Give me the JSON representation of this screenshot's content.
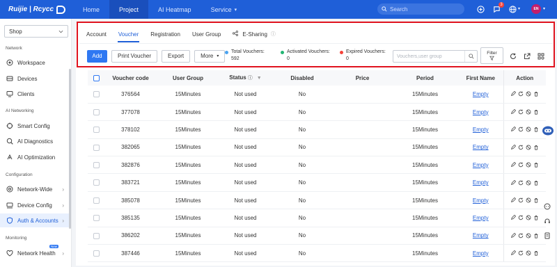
{
  "brand": {
    "logo_text": "Ruijie | Rcycc"
  },
  "topnav": {
    "items": [
      {
        "label": "Home"
      },
      {
        "label": "Project"
      },
      {
        "label": "AI Heatmap"
      },
      {
        "label": "Service"
      }
    ],
    "search_placeholder": "Search",
    "notification_count": "3",
    "avatar_text": "EN"
  },
  "sidebar": {
    "shop_select": "Shop",
    "sections": [
      {
        "title": "Network",
        "items": [
          {
            "label": "Workspace"
          },
          {
            "label": "Devices"
          },
          {
            "label": "Clients"
          }
        ]
      },
      {
        "title": "AI Networking",
        "items": [
          {
            "label": "Smart Config"
          },
          {
            "label": "AI Diagnostics"
          },
          {
            "label": "AI Optimization"
          }
        ]
      },
      {
        "title": "Configuration",
        "items": [
          {
            "label": "Network-Wide"
          },
          {
            "label": "Device Config"
          },
          {
            "label": "Auth & Accounts"
          }
        ]
      },
      {
        "title": "Monitoring",
        "items": [
          {
            "label": "Network Health"
          }
        ]
      }
    ],
    "new_tag": "New"
  },
  "tabs": [
    {
      "label": "Account"
    },
    {
      "label": "Voucher"
    },
    {
      "label": "Registration"
    },
    {
      "label": "User Group"
    },
    {
      "label": "E-Sharing"
    }
  ],
  "toolbar": {
    "add": "Add",
    "print": "Print Voucher",
    "export": "Export",
    "more": "More",
    "filter": "Filter",
    "search_placeholder": "Vouchers,user group"
  },
  "stats": {
    "total_label": "Total Vouchers:",
    "total_value": "592",
    "activated_label": "Activated Vouchers:",
    "activated_value": "0",
    "expired_label": "Expired Vouchers:",
    "expired_value": "0",
    "colors": {
      "total": "#4aa3f0",
      "activated": "#22b573",
      "expired": "#f5433a"
    }
  },
  "table": {
    "columns": [
      "Voucher code",
      "User Group",
      "Status",
      "Disabled",
      "Price",
      "Period",
      "First Name",
      "Action"
    ],
    "rows": [
      {
        "code": "376564",
        "group": "15Minutes",
        "status": "Not used",
        "disabled": "No",
        "price": "",
        "period": "15Minutes",
        "first_name": "Empty"
      },
      {
        "code": "377078",
        "group": "15Minutes",
        "status": "Not used",
        "disabled": "No",
        "price": "",
        "period": "15Minutes",
        "first_name": "Empty"
      },
      {
        "code": "378102",
        "group": "15Minutes",
        "status": "Not used",
        "disabled": "No",
        "price": "",
        "period": "15Minutes",
        "first_name": "Empty"
      },
      {
        "code": "382065",
        "group": "15Minutes",
        "status": "Not used",
        "disabled": "No",
        "price": "",
        "period": "15Minutes",
        "first_name": "Empty"
      },
      {
        "code": "382876",
        "group": "15Minutes",
        "status": "Not used",
        "disabled": "No",
        "price": "",
        "period": "15Minutes",
        "first_name": "Empty"
      },
      {
        "code": "383721",
        "group": "15Minutes",
        "status": "Not used",
        "disabled": "No",
        "price": "",
        "period": "15Minutes",
        "first_name": "Empty"
      },
      {
        "code": "385078",
        "group": "15Minutes",
        "status": "Not used",
        "disabled": "No",
        "price": "",
        "period": "15Minutes",
        "first_name": "Empty"
      },
      {
        "code": "385135",
        "group": "15Minutes",
        "status": "Not used",
        "disabled": "No",
        "price": "",
        "period": "15Minutes",
        "first_name": "Empty"
      },
      {
        "code": "386202",
        "group": "15Minutes",
        "status": "Not used",
        "disabled": "No",
        "price": "",
        "period": "15Minutes",
        "first_name": "Empty"
      },
      {
        "code": "387446",
        "group": "15Minutes",
        "status": "Not used",
        "disabled": "No",
        "price": "",
        "period": "15Minutes",
        "first_name": "Empty"
      }
    ]
  }
}
